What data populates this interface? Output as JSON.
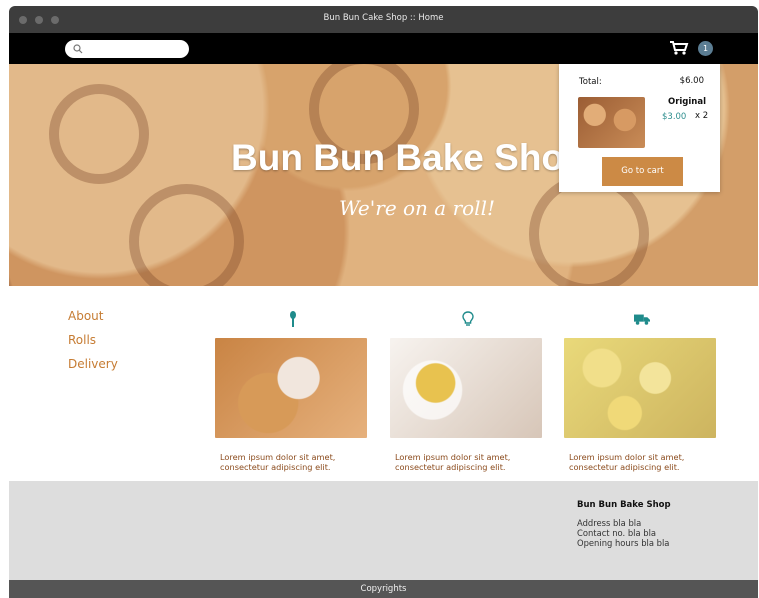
{
  "window": {
    "title": "Bun Bun Cake Shop :: Home"
  },
  "nav": {
    "cart_count": "1"
  },
  "hero": {
    "title": "Bun Bun Bake Shop",
    "subtitle": "We're on a roll!"
  },
  "cart_popup": {
    "total_label": "Total:",
    "total_value": "$6.00",
    "item_name": "Original",
    "item_price": "$3.00",
    "item_qty": "x 2",
    "button": "Go to cart"
  },
  "menu": {
    "items": [
      "About",
      "Rolls",
      "Delivery"
    ]
  },
  "features": [
    {
      "icon": "spoon-icon",
      "text": "Lorem ipsum dolor sit amet, consectetur adipiscing elit."
    },
    {
      "icon": "lightbulb-icon",
      "text": "Lorem ipsum dolor sit amet, consectetur adipiscing elit."
    },
    {
      "icon": "truck-icon",
      "text": "Lorem ipsum dolor sit amet, consectetur adipiscing elit."
    }
  ],
  "footer": {
    "title": "Bun Bun Bake Shop",
    "lines": [
      "Address bla bla",
      "Contact no. bla bla",
      "Opening hours bla bla"
    ],
    "copyright": "Copyrights"
  },
  "colors": {
    "accent": "#cc8a45",
    "teal": "#1f8b8b",
    "footer_bg": "#dddddd"
  }
}
